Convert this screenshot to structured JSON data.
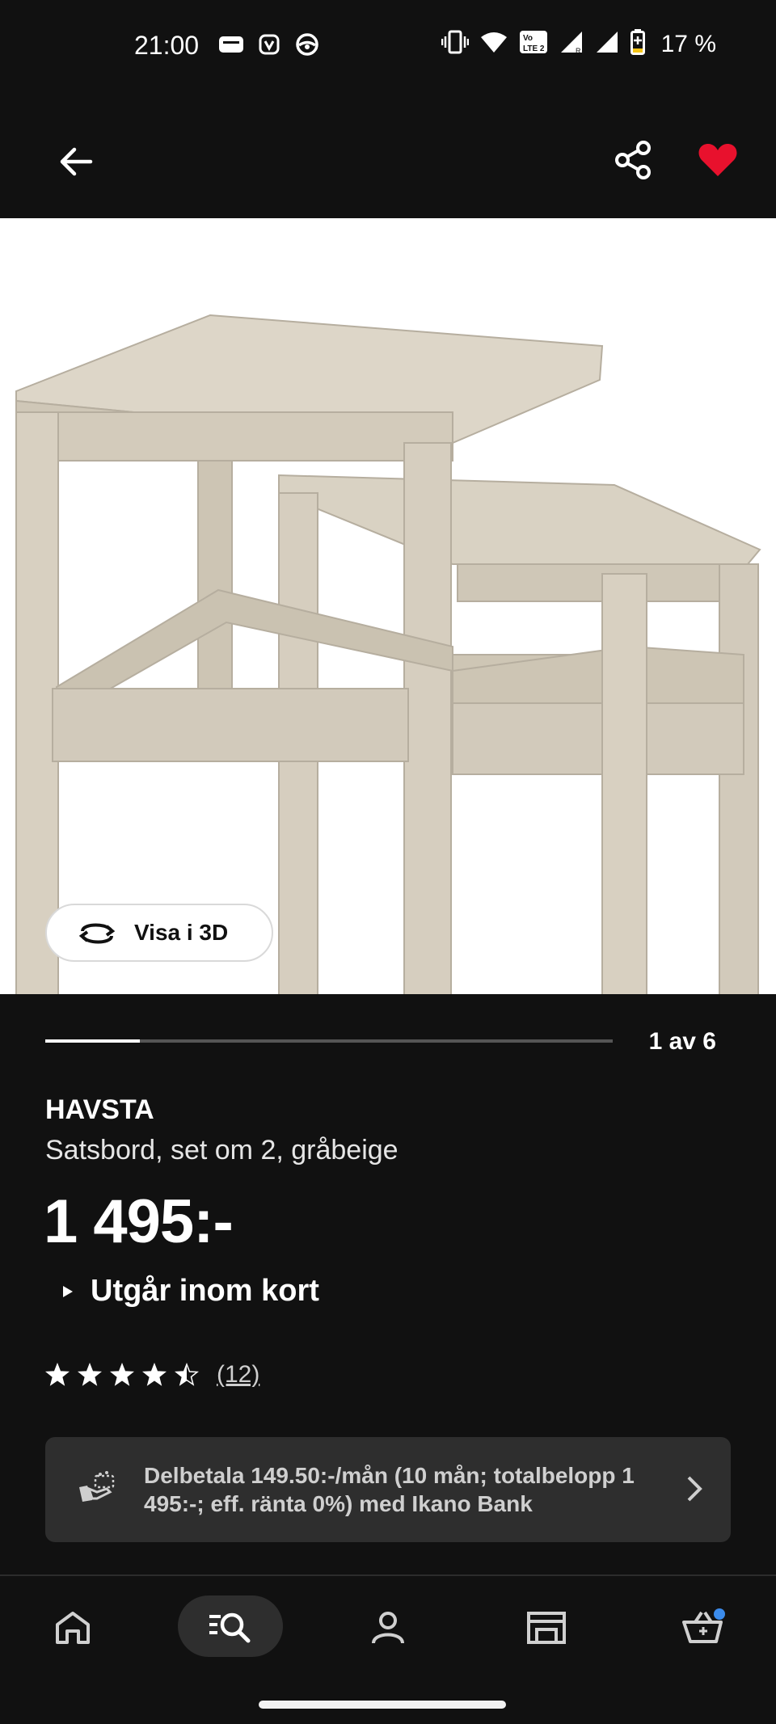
{
  "status_bar": {
    "time": "21:00",
    "battery_percent": "17 %",
    "icons_left": [
      "wallet-icon",
      "vpn-icon",
      "steering-icon"
    ],
    "icons_right": [
      "vibrate-icon",
      "wifi-icon",
      "volte-icon",
      "signal-icon",
      "signal-icon",
      "battery-icon"
    ]
  },
  "top_bar": {
    "back_icon": "arrow-left-icon",
    "share_icon": "share-icon",
    "favorite_icon": "heart-icon",
    "favorite_color": "#e8112d"
  },
  "gallery": {
    "view_3d_label": "Visa i 3D",
    "pager_text": "1 av 6",
    "current_index": 1,
    "total_images": 6
  },
  "product": {
    "name": "HAVSTA",
    "description": "Satsbord, set om 2, gråbeige",
    "price": "1 495:-",
    "stock_status": "Utgår inom kort",
    "rating_value": 4.5,
    "rating_max": 5,
    "rating_count": "(12)"
  },
  "financing": {
    "text": "Delbetala 149.50:-/mån (10 mån; totalbelopp 1 495:-; eff. ränta 0%) med Ikano Bank"
  },
  "bottom_nav": {
    "items": [
      "home-icon",
      "search-icon",
      "profile-icon",
      "store-icon",
      "cart-icon"
    ],
    "active": "search-icon",
    "cart_dot_color": "#3b8beb"
  },
  "colors": {
    "background": "#111111",
    "panel": "#2e2e2e",
    "product_wood": "#d9d2c3"
  }
}
